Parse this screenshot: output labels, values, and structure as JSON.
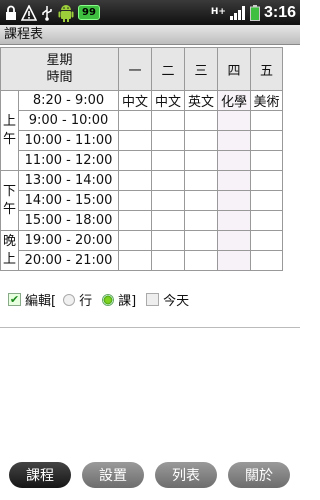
{
  "status_bar": {
    "battery": "99",
    "network": "H+",
    "time": "3:16"
  },
  "title": "課程表",
  "table": {
    "header_week": "星期",
    "header_time": "時間",
    "days": [
      "一",
      "二",
      "三",
      "四",
      "五"
    ],
    "periods": [
      {
        "label": "上午",
        "rows": 4
      },
      {
        "label": "下午",
        "rows": 3
      },
      {
        "label": "晚上",
        "rows": 2
      }
    ],
    "times": [
      "8:20 - 9:00",
      "9:00 - 10:00",
      "10:00 - 11:00",
      "11:00 - 12:00",
      "13:00 - 14:00",
      "14:00 - 15:00",
      "15:00 - 18:00",
      "19:00 - 20:00",
      "20:00 - 21:00"
    ],
    "courses": [
      [
        "中文",
        "中文",
        "英文",
        "化學",
        "美術"
      ],
      [
        "",
        "",
        "",
        "",
        ""
      ],
      [
        "",
        "",
        "",
        "",
        ""
      ],
      [
        "",
        "",
        "",
        "",
        ""
      ],
      [
        "",
        "",
        "",
        "",
        ""
      ],
      [
        "",
        "",
        "",
        "",
        ""
      ],
      [
        "",
        "",
        "",
        "",
        ""
      ],
      [
        "",
        "",
        "",
        "",
        ""
      ],
      [
        "",
        "",
        "",
        "",
        ""
      ]
    ]
  },
  "controls": {
    "edit_label": "編輯[",
    "edit_checked": true,
    "radio_row_label": "行",
    "radio_course_label": "課]",
    "radio_selected": "course",
    "today_label": "今天",
    "today_checked": false
  },
  "tabs": [
    {
      "label": "課程",
      "active": true
    },
    {
      "label": "設置",
      "active": false
    },
    {
      "label": "列表",
      "active": false
    },
    {
      "label": "關於",
      "active": false
    }
  ],
  "colors": {
    "accent_green": "#7ed321",
    "header_gray": "#e6e6e6",
    "tab_active": "#161616",
    "tab_inactive": "#7a7a7a"
  }
}
